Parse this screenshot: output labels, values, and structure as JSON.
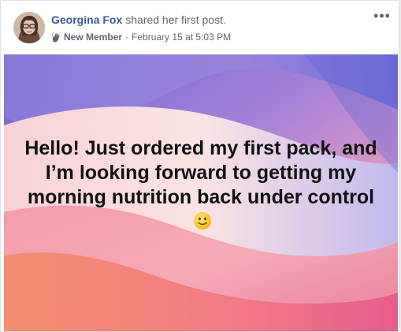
{
  "post": {
    "author_name": "Georgina Fox",
    "action_text": "shared her first post.",
    "badge_icon": "hand-wave-icon",
    "badge_label": "New Member",
    "separator": "·",
    "timestamp": "February 15 at 5:03 PM",
    "more_label": "•••",
    "text": "Hello! Just ordered my first pack, and I’m looking forward to getting my morning nutrition back under control",
    "emoji": "slightly-smiling-face-icon"
  },
  "colors": {
    "link": "#385898",
    "meta": "#616770",
    "background_purple": "#7b6fd8",
    "background_pink": "#f08aa6",
    "background_orange": "#f49b7a"
  }
}
